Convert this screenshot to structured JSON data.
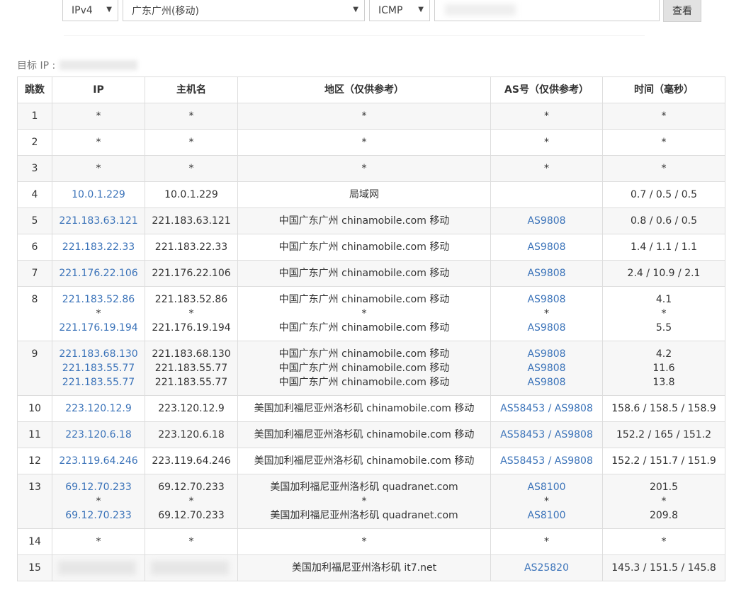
{
  "toolbar": {
    "ip_version": "IPv4",
    "node": "广东广州(移动)",
    "protocol": "ICMP",
    "query_button": "查看"
  },
  "target_label": "目标 IP :",
  "table": {
    "headers": [
      "跳数",
      "IP",
      "主机名",
      "地区（仅供参考）",
      "AS号（仅供参考）",
      "时间（毫秒）"
    ],
    "rows": [
      {
        "hop": "1",
        "ip": [
          "*"
        ],
        "host": [
          "*"
        ],
        "region": [
          "*"
        ],
        "as": [
          "*"
        ],
        "time": [
          "*"
        ]
      },
      {
        "hop": "2",
        "ip": [
          "*"
        ],
        "host": [
          "*"
        ],
        "region": [
          "*"
        ],
        "as": [
          "*"
        ],
        "time": [
          "*"
        ]
      },
      {
        "hop": "3",
        "ip": [
          "*"
        ],
        "host": [
          "*"
        ],
        "region": [
          "*"
        ],
        "as": [
          "*"
        ],
        "time": [
          "*"
        ]
      },
      {
        "hop": "4",
        "ip": [
          "10.0.1.229"
        ],
        "host": [
          "10.0.1.229"
        ],
        "region": [
          "局域网"
        ],
        "as": [
          ""
        ],
        "time": [
          "0.7 / 0.5 / 0.5"
        ]
      },
      {
        "hop": "5",
        "ip": [
          "221.183.63.121"
        ],
        "host": [
          "221.183.63.121"
        ],
        "region": [
          "中国广东广州 chinamobile.com 移动"
        ],
        "as": [
          "AS9808"
        ],
        "time": [
          "0.8 / 0.6 / 0.5"
        ]
      },
      {
        "hop": "6",
        "ip": [
          "221.183.22.33"
        ],
        "host": [
          "221.183.22.33"
        ],
        "region": [
          "中国广东广州 chinamobile.com 移动"
        ],
        "as": [
          "AS9808"
        ],
        "time": [
          "1.4 / 1.1 / 1.1"
        ]
      },
      {
        "hop": "7",
        "ip": [
          "221.176.22.106"
        ],
        "host": [
          "221.176.22.106"
        ],
        "region": [
          "中国广东广州 chinamobile.com 移动"
        ],
        "as": [
          "AS9808"
        ],
        "time": [
          "2.4 / 10.9 / 2.1"
        ]
      },
      {
        "hop": "8",
        "ip": [
          "221.183.52.86",
          "*",
          "221.176.19.194"
        ],
        "host": [
          "221.183.52.86",
          "*",
          "221.176.19.194"
        ],
        "region": [
          "中国广东广州 chinamobile.com 移动",
          "*",
          "中国广东广州 chinamobile.com 移动"
        ],
        "as": [
          "AS9808",
          "*",
          "AS9808"
        ],
        "time": [
          "4.1",
          "*",
          "5.5"
        ]
      },
      {
        "hop": "9",
        "ip": [
          "221.183.68.130",
          "221.183.55.77",
          "221.183.55.77"
        ],
        "host": [
          "221.183.68.130",
          "221.183.55.77",
          "221.183.55.77"
        ],
        "region": [
          "中国广东广州 chinamobile.com 移动",
          "中国广东广州 chinamobile.com 移动",
          "中国广东广州 chinamobile.com 移动"
        ],
        "as": [
          "AS9808",
          "AS9808",
          "AS9808"
        ],
        "time": [
          "4.2",
          "11.6",
          "13.8"
        ]
      },
      {
        "hop": "10",
        "ip": [
          "223.120.12.9"
        ],
        "host": [
          "223.120.12.9"
        ],
        "region": [
          "美国加利福尼亚州洛杉矶 chinamobile.com 移动"
        ],
        "as": [
          "AS58453 / AS9808"
        ],
        "time": [
          "158.6 / 158.5 / 158.9"
        ]
      },
      {
        "hop": "11",
        "ip": [
          "223.120.6.18"
        ],
        "host": [
          "223.120.6.18"
        ],
        "region": [
          "美国加利福尼亚州洛杉矶 chinamobile.com 移动"
        ],
        "as": [
          "AS58453 / AS9808"
        ],
        "time": [
          "152.2 / 165 / 151.2"
        ]
      },
      {
        "hop": "12",
        "ip": [
          "223.119.64.246"
        ],
        "host": [
          "223.119.64.246"
        ],
        "region": [
          "美国加利福尼亚州洛杉矶 chinamobile.com 移动"
        ],
        "as": [
          "AS58453 / AS9808"
        ],
        "time": [
          "152.2 / 151.7 / 151.9"
        ]
      },
      {
        "hop": "13",
        "ip": [
          "69.12.70.233",
          "*",
          "69.12.70.233"
        ],
        "host": [
          "69.12.70.233",
          "*",
          "69.12.70.233"
        ],
        "region": [
          "美国加利福尼亚州洛杉矶 quadranet.com",
          "*",
          "美国加利福尼亚州洛杉矶 quadranet.com"
        ],
        "as": [
          "AS8100",
          "*",
          "AS8100"
        ],
        "time": [
          "201.5",
          "*",
          "209.8"
        ]
      },
      {
        "hop": "14",
        "ip": [
          "*"
        ],
        "host": [
          "*"
        ],
        "region": [
          "*"
        ],
        "as": [
          "*"
        ],
        "time": [
          "*"
        ]
      },
      {
        "hop": "15",
        "ip": [
          ""
        ],
        "host": [
          ""
        ],
        "region": [
          "美国加利福尼亚州洛杉矶 it7.net"
        ],
        "as": [
          "AS25820"
        ],
        "time": [
          "145.3 / 151.5 / 145.8"
        ]
      }
    ]
  }
}
